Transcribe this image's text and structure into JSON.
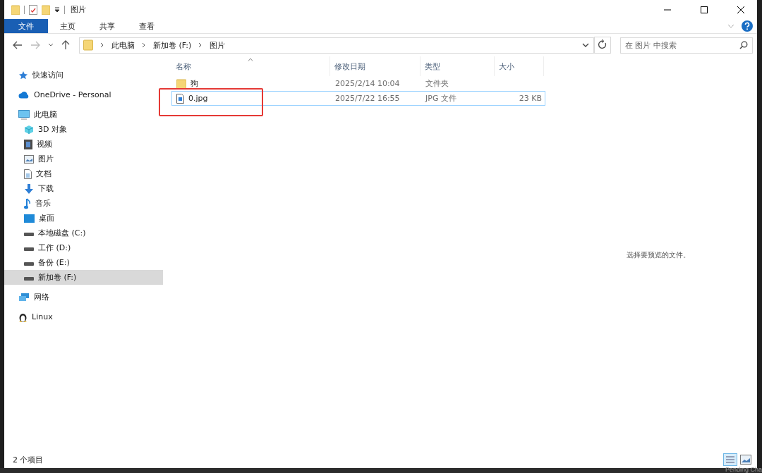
{
  "window": {
    "title": "图片"
  },
  "ribbon_tabs": [
    {
      "label": "文件",
      "selected": true
    },
    {
      "label": "主页",
      "selected": false
    },
    {
      "label": "共享",
      "selected": false
    },
    {
      "label": "查看",
      "selected": false
    }
  ],
  "address_bar": {
    "path": [
      "此电脑",
      "新加卷 (F:)",
      "图片"
    ]
  },
  "search": {
    "placeholder": "在 图片 中搜索"
  },
  "sidebar": {
    "items": [
      {
        "label": "快速访问",
        "kind": "star",
        "selected": false
      },
      {
        "label": "OneDrive - Personal",
        "kind": "cloud",
        "selected": false
      },
      {
        "label": "此电脑",
        "kind": "pc",
        "selected": false,
        "children": [
          {
            "label": "3D 对象",
            "kind": "cube",
            "selected": false
          },
          {
            "label": "视频",
            "kind": "film",
            "selected": false
          },
          {
            "label": "图片",
            "kind": "picture",
            "selected": false
          },
          {
            "label": "文档",
            "kind": "document",
            "selected": false
          },
          {
            "label": "下载",
            "kind": "download",
            "selected": false
          },
          {
            "label": "音乐",
            "kind": "music",
            "selected": false
          },
          {
            "label": "桌面",
            "kind": "desktop",
            "selected": false
          },
          {
            "label": "本地磁盘 (C:)",
            "kind": "drive",
            "selected": false
          },
          {
            "label": "工作 (D:)",
            "kind": "drive",
            "selected": false
          },
          {
            "label": "备份 (E:)",
            "kind": "drive",
            "selected": false
          },
          {
            "label": "新加卷 (F:)",
            "kind": "drive",
            "selected": true
          }
        ]
      },
      {
        "label": "网络",
        "kind": "network",
        "selected": false
      },
      {
        "label": "Linux",
        "kind": "penguin",
        "selected": false
      }
    ]
  },
  "table": {
    "columns": [
      "名称",
      "修改日期",
      "类型",
      "大小"
    ],
    "rows": [
      {
        "kind": "folder",
        "name": "狗",
        "date": "2025/2/14 10:04",
        "type": "文件夹",
        "focused": false,
        "annotated": false
      },
      {
        "kind": "image",
        "name": "0.jpg",
        "date": "2025/7/22 16:55",
        "type": "JPG 文件",
        "size": "23 KB",
        "focused": true,
        "annotated": true
      }
    ]
  },
  "preview_pane": {
    "message": "选择要预览的文件。"
  },
  "status_bar": {
    "item_count": "2 个项目"
  },
  "background_window": {
    "text": "Pending Cha"
  }
}
